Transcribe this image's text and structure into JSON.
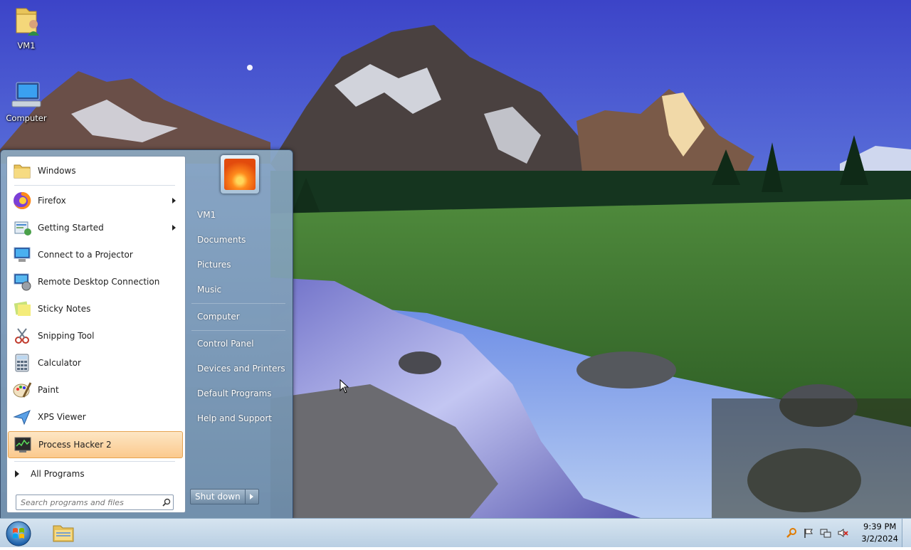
{
  "desktop": {
    "icons": [
      {
        "label": "VM1"
      },
      {
        "label": "Computer"
      }
    ]
  },
  "start_menu": {
    "programs": [
      {
        "label": "Windows",
        "icon": "folder-icon"
      },
      {
        "label": "Firefox",
        "icon": "firefox-icon",
        "has_submenu": true
      },
      {
        "label": "Getting Started",
        "icon": "getting-started-icon",
        "has_submenu": true
      },
      {
        "label": "Connect to a Projector",
        "icon": "projector-icon"
      },
      {
        "label": "Remote Desktop Connection",
        "icon": "remote-desktop-icon"
      },
      {
        "label": "Sticky Notes",
        "icon": "sticky-notes-icon"
      },
      {
        "label": "Snipping Tool",
        "icon": "snipping-tool-icon"
      },
      {
        "label": "Calculator",
        "icon": "calculator-icon"
      },
      {
        "label": "Paint",
        "icon": "paint-icon"
      },
      {
        "label": "XPS Viewer",
        "icon": "xps-viewer-icon"
      },
      {
        "label": "Process Hacker 2",
        "icon": "process-hacker-icon",
        "highlighted": true
      }
    ],
    "all_programs": "All Programs",
    "search_placeholder": "Search programs and files",
    "right_items": [
      {
        "label": "VM1"
      },
      {
        "label": "Documents"
      },
      {
        "label": "Pictures"
      },
      {
        "label": "Music"
      },
      {
        "label": "Computer"
      },
      {
        "label": "Control Panel"
      },
      {
        "label": "Devices and Printers"
      },
      {
        "label": "Default Programs"
      },
      {
        "label": "Help and Support"
      }
    ],
    "shutdown_label": "Shut down"
  },
  "taskbar": {
    "clock_time": "9:39 PM",
    "clock_date": "3/2/2024"
  },
  "colors": {
    "highlight": "#fbc98d",
    "taskbar": "#c9dbeb"
  }
}
